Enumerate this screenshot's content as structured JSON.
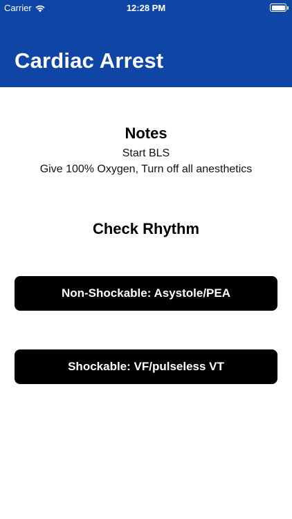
{
  "status_bar": {
    "carrier": "Carrier",
    "time": "12:28 PM",
    "icons": [
      "wifi-icon",
      "battery-icon"
    ]
  },
  "header": {
    "title": "Cardiac Arrest",
    "background_color": "#0f46a5"
  },
  "notes": {
    "title": "Notes",
    "lines": [
      "Start BLS",
      "Give 100% Oxygen, Turn off all anesthetics"
    ]
  },
  "rhythm": {
    "title": "Check Rhythm",
    "buttons": [
      {
        "label": "Non-Shockable: Asystole/PEA"
      },
      {
        "label": "Shockable: VF/pulseless VT"
      }
    ]
  }
}
